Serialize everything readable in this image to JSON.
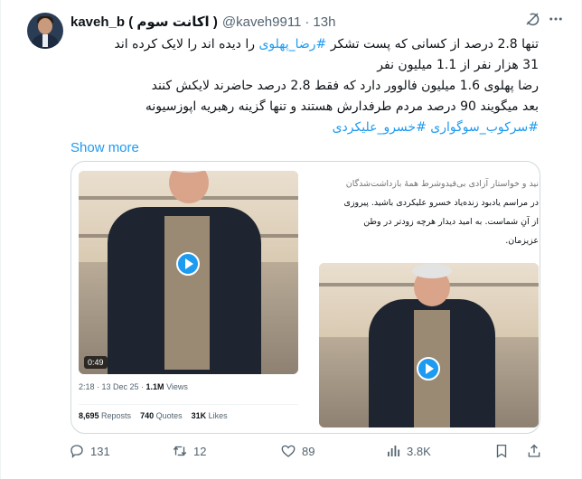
{
  "tweet": {
    "author": {
      "display_name": "kaveh_b ( اکانت سوم )",
      "handle": "@kaveh9911",
      "time": "13h"
    },
    "lines": {
      "l1a": "تنها 2.8 درصد از کسانی که پست تشکر ",
      "l1tag": "#رضا_پهلوی",
      "l1b": " را دیده اند را لایک کرده اند",
      "l2": "31 هزار نفر از 1.1 میلیون نفر",
      "l3": "رضا پهلوی 1.6 میلیون فالوور دارد که فقط 2.8 درصد حاضرند لایکش کنند",
      "l4": "بعد میگویند 90 درصد مردم طرفدارش هستند و تنها گزینه رهبریه اپوزسیونه",
      "tag1": "#سرکوب_سوگواری",
      "tag2": "#خسرو_علیکردی"
    },
    "show_more": "Show more"
  },
  "quoted": {
    "duration": "0:49",
    "meta": {
      "time": "2:18 · 13 Dec 25 · ",
      "views_count": "1.1M",
      "views_label": " Views"
    },
    "stats": {
      "reposts_count": "8,695",
      "reposts_label": " Reposts",
      "quotes_count": "740",
      "quotes_label": " Quotes",
      "likes_count": "31K",
      "likes_label": " Likes"
    },
    "caption": [
      "نید و خواستار آزادی بی‌قیدوشرط همهٔ بازداشت‌شدگان",
      "در مراسم یادبود زنده‌یاد خسرو علیکردی باشید. پیروزی",
      "از آنِ شماست. به امید دیدار هرچه زودتر در وطن",
      "عزیزمان."
    ]
  },
  "actions": {
    "replies": "131",
    "reposts": "12",
    "likes": "89",
    "views": "3.8K"
  },
  "colors": {
    "accent": "#1d9bf0",
    "text": "#0f1419",
    "secondary": "#536471",
    "border": "#cfd9de"
  },
  "icons": [
    "grok-icon",
    "more-icon",
    "play-icon",
    "reply-icon",
    "retweet-icon",
    "like-icon",
    "views-icon",
    "bookmark-icon",
    "share-icon"
  ]
}
